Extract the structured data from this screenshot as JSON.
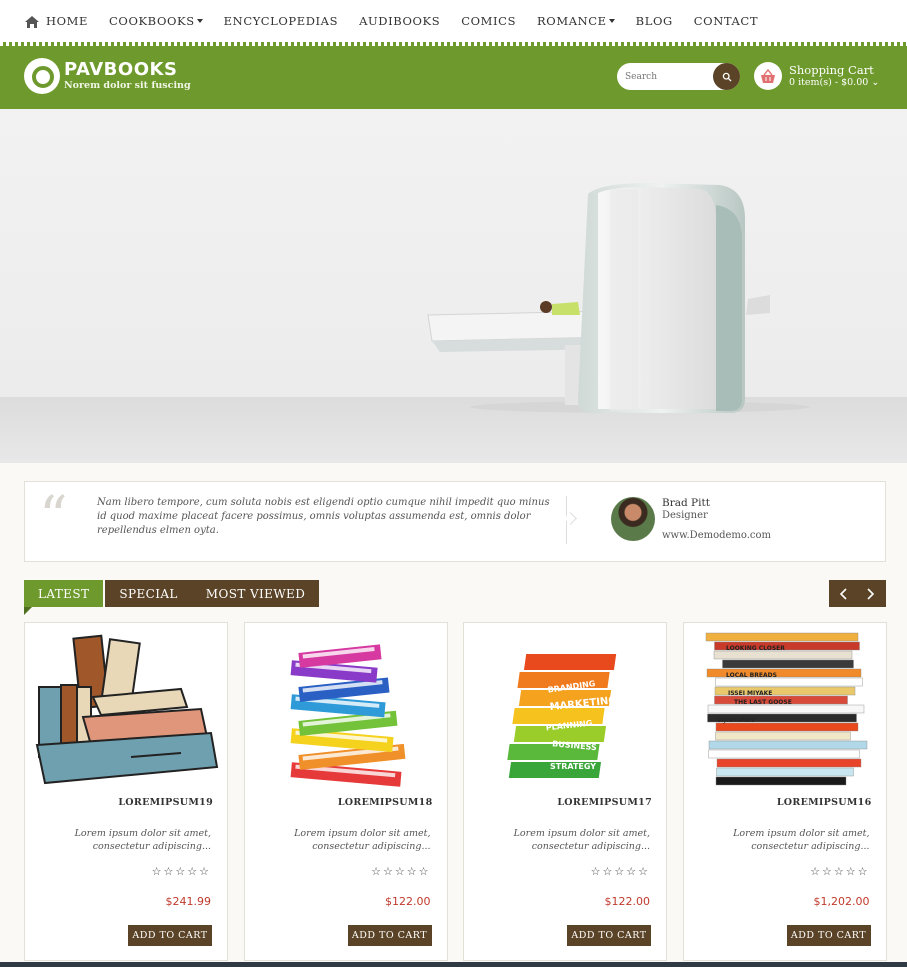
{
  "nav": {
    "items": [
      {
        "label": "HOME",
        "dropdown": false
      },
      {
        "label": "COOKBOOKS",
        "dropdown": true
      },
      {
        "label": "ENCYCLOPEDIAS",
        "dropdown": false
      },
      {
        "label": "AUDIBOOKS",
        "dropdown": false
      },
      {
        "label": "COMICS",
        "dropdown": false
      },
      {
        "label": "ROMANCE",
        "dropdown": true
      },
      {
        "label": "BLOG",
        "dropdown": false
      },
      {
        "label": "CONTACT",
        "dropdown": false
      }
    ]
  },
  "header": {
    "logo_title": "PAVBOOKS",
    "logo_tagline": "Norem dolor sit fuscing",
    "search_placeholder": "Search",
    "cart_title": "Shopping Cart",
    "cart_summary": "0 item(s) - $0.00"
  },
  "testimonial": {
    "quote": "Nam libero tempore, cum soluta nobis est eligendi optio cumque nihil impedit quo minus id quod maxime placeat facere possimus, omnis voluptas assumenda est, omnis dolor repellendus elmen oyta.",
    "author": "Brad Pitt",
    "role": "Designer",
    "site": "www.Demodemo.com"
  },
  "tabs": [
    {
      "label": "LATEST",
      "active": true
    },
    {
      "label": "SPECIAL",
      "active": false
    },
    {
      "label": "MOST VIEWED",
      "active": false
    }
  ],
  "products": [
    {
      "name": "LOREMIPSUM19",
      "desc": "Lorem ipsum dolor sit amet, consectetur adipiscing...",
      "price": "$241.99",
      "rating": 0,
      "button": "ADD TO CART",
      "image": "cartoon-books"
    },
    {
      "name": "LOREMIPSUM18",
      "desc": "Lorem ipsum dolor sit amet, consectetur adipiscing...",
      "price": "$122.00",
      "rating": 0,
      "button": "ADD TO CART",
      "image": "rainbow-book-stack"
    },
    {
      "name": "LOREMIPSUM17",
      "desc": "Lorem ipsum dolor sit amet, consectetur adipiscing...",
      "price": "$122.00",
      "rating": 0,
      "button": "ADD TO CART",
      "image": "marketing-book-stack"
    },
    {
      "name": "LOREMIPSUM16",
      "desc": "Lorem ipsum dolor sit amet, consectetur adipiscing...",
      "price": "$1,202.00",
      "rating": 0,
      "button": "ADD TO CART",
      "image": "real-book-stack"
    }
  ],
  "hero_spine_labels": [
    "BRANDING",
    "MARKETING",
    "PLANNING",
    "BUSINESS",
    "STRATEGY"
  ],
  "stack_spine_labels": [
    "LOOKING CLOSER",
    "LOCAL BREADS",
    "ISSEI MIYAKE",
    "THE LAST GOOSE",
    "stylemakers"
  ],
  "colors": {
    "brand_green": "#6e9a2d",
    "brown": "#5a4326",
    "price_red": "#c0392b"
  }
}
